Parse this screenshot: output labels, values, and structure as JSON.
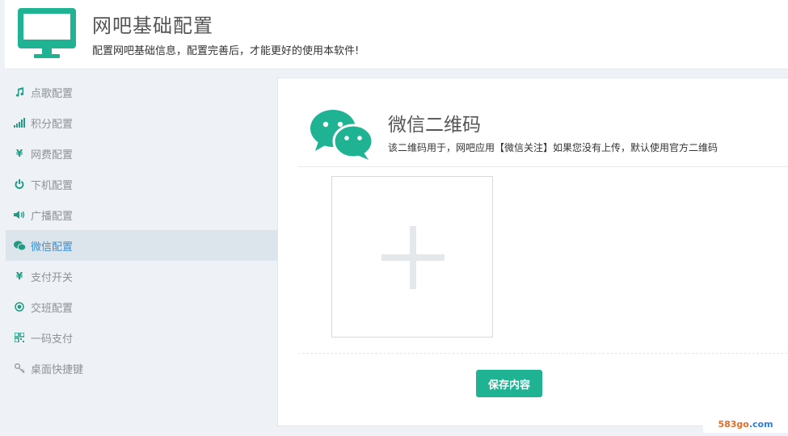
{
  "colors": {
    "brand": "#1fb394",
    "active_bg": "#dde5ec",
    "active_text": "#3a8fd3",
    "sidebar_text": "#8c9399"
  },
  "header": {
    "icon": "monitor-icon",
    "title": "网吧基础配置",
    "subtitle": "配置网吧基础信息，配置完善后，才能更好的使用本软件!"
  },
  "sidebar": {
    "items": [
      {
        "label": "点歌配置",
        "icon": "music-icon",
        "active": false
      },
      {
        "label": "积分配置",
        "icon": "signal-bars-icon",
        "active": false
      },
      {
        "label": "网费配置",
        "icon": "yen-icon",
        "active": false
      },
      {
        "label": "下机配置",
        "icon": "power-icon",
        "active": false
      },
      {
        "label": "广播配置",
        "icon": "speaker-icon",
        "active": false
      },
      {
        "label": "微信配置",
        "icon": "wechat-icon",
        "active": true
      },
      {
        "label": "支付开关",
        "icon": "yen-icon",
        "active": false
      },
      {
        "label": "交班配置",
        "icon": "target-icon",
        "active": false
      },
      {
        "label": "一码支付",
        "icon": "qrcode-icon",
        "active": false
      },
      {
        "label": "桌面快捷键",
        "icon": "key-icon",
        "active": false
      }
    ]
  },
  "main": {
    "section_icon": "wechat-icon",
    "section_title": "微信二维码",
    "section_desc": "该二维码用于，网吧应用【微信关注】如果您没有上传，默认使用官方二维码",
    "upload_icon": "plus-icon",
    "save_label": "保存内容"
  },
  "watermark": {
    "part_a": "583go",
    "part_b": ".com"
  }
}
